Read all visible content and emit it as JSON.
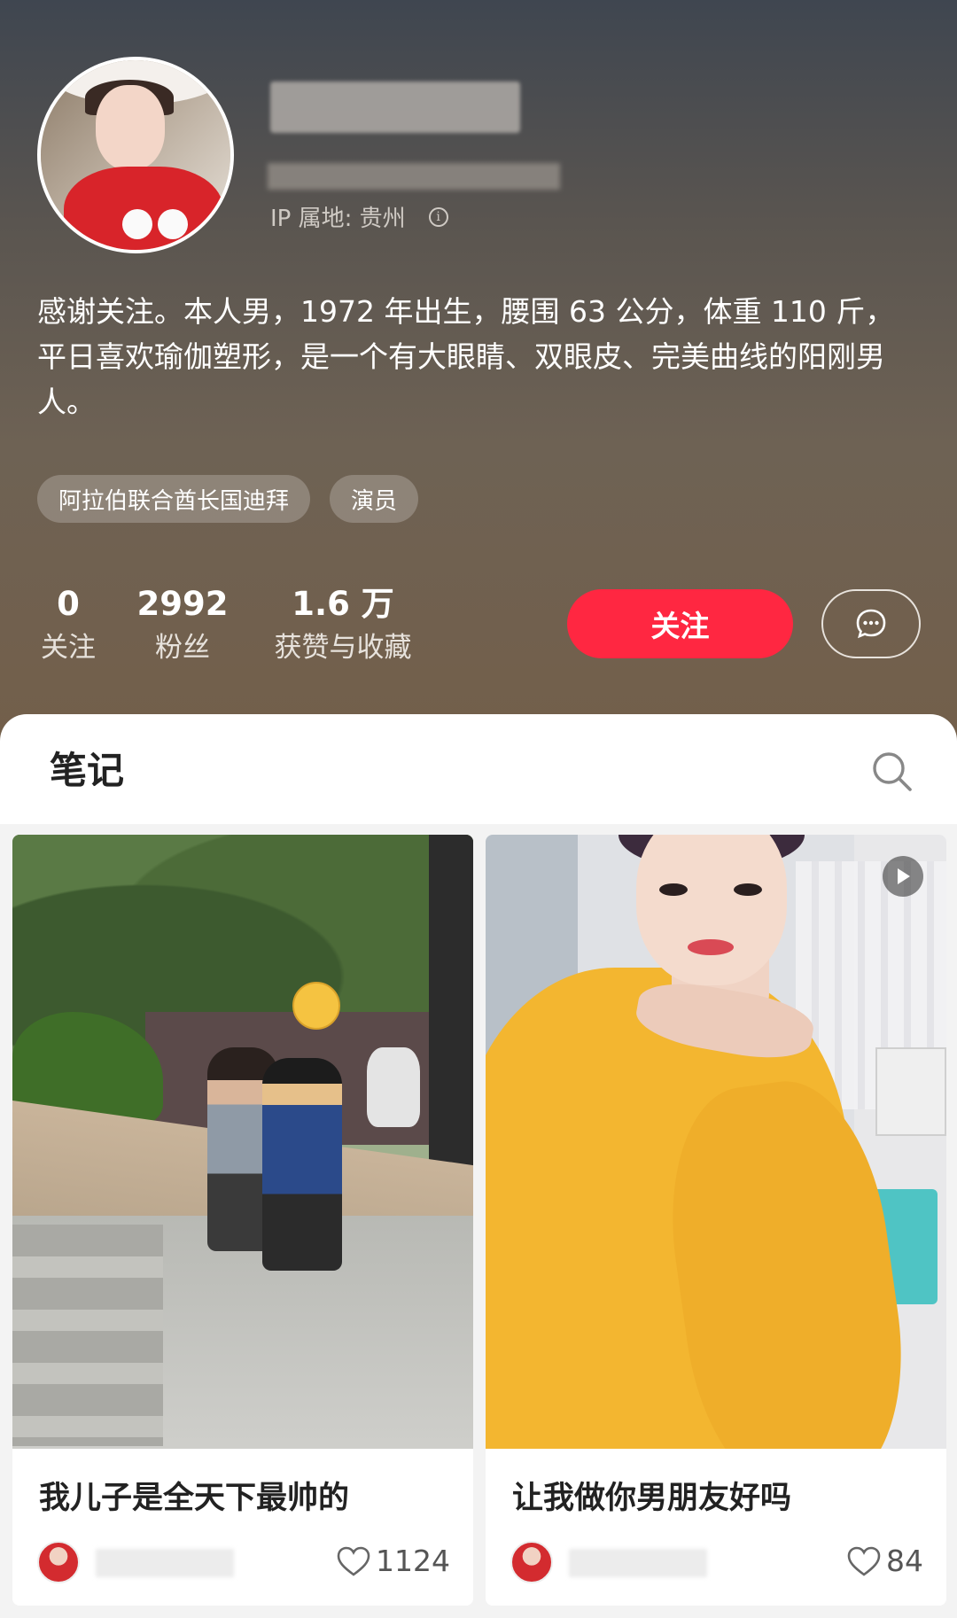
{
  "profile": {
    "ip_location": "IP 属地: 贵州",
    "bio": "感谢关注。本人男，1972 年出生，腰围 63 公分，体重 110 斤，平日喜欢瑜伽塑形，是一个有大眼睛、双眼皮、完美曲线的阳刚男人。",
    "tags": [
      "阿拉伯联合酋长国迪拜",
      "演员"
    ],
    "stats": [
      {
        "value": "0",
        "label": "关注"
      },
      {
        "value": "2992",
        "label": "粉丝"
      },
      {
        "value": "1.6 万",
        "label": "获赞与收藏"
      }
    ],
    "follow_label": "关注",
    "message_icon": "chat-bubble-icon"
  },
  "notes": {
    "title": "笔记",
    "search_icon": "search-icon",
    "items": [
      {
        "caption": "我儿子是全天下最帅的",
        "likes": "1124",
        "has_video": false
      },
      {
        "caption": "让我做你男朋友好吗",
        "likes": "84",
        "has_video": true
      }
    ]
  },
  "colors": {
    "accent": "#ff2741",
    "header_top": "#3f4650",
    "header_bottom": "#735f4a"
  }
}
